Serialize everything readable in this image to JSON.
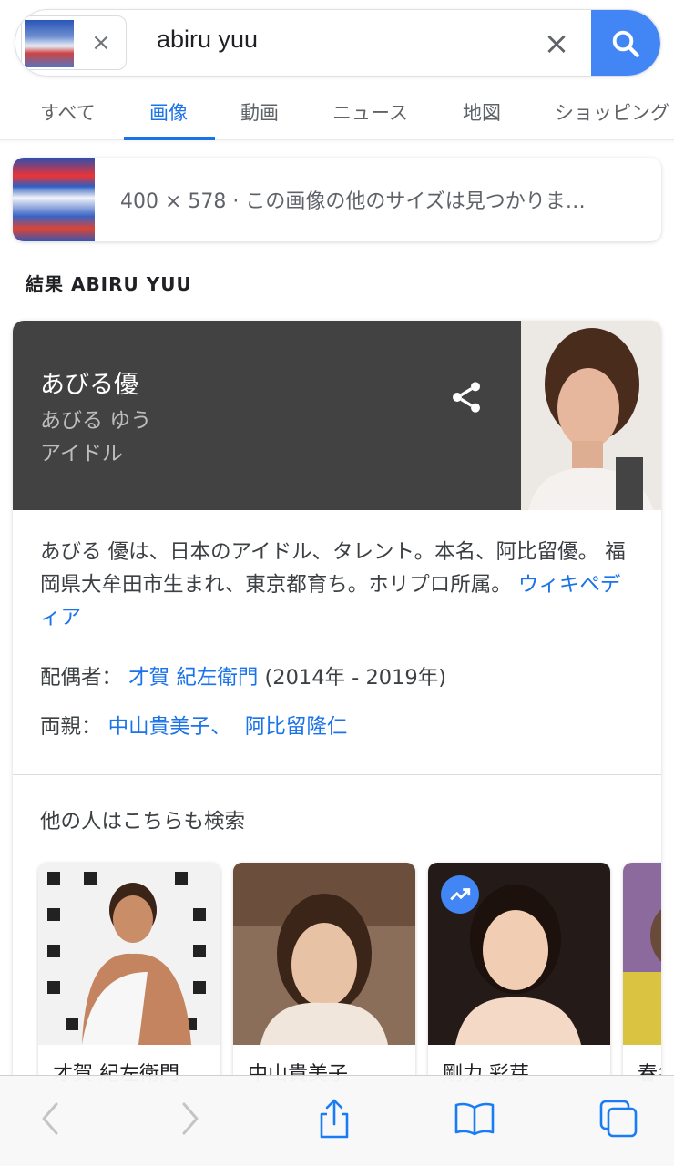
{
  "search": {
    "query": "abiru yuu",
    "chip_remove": "×",
    "clear": "×"
  },
  "tabs": [
    {
      "label": "すべて"
    },
    {
      "label": "画像",
      "active": true
    },
    {
      "label": "動画"
    },
    {
      "label": "ニュース"
    },
    {
      "label": "地図"
    },
    {
      "label": "ショッピング"
    }
  ],
  "image_info": {
    "text": "400 × 578 · この画像の他のサイズは見つかりま…"
  },
  "results_heading": "結果 ABIRU YUU",
  "knowledge_panel": {
    "name": "あびる優",
    "reading": "あびる ゆう",
    "type": "アイドル",
    "description": "あびる 優は、日本のアイドル、タレント。本名、阿比留優。 福岡県大牟田市生まれ、東京都育ち。ホリプロ所属。",
    "source_link": "ウィキペディア",
    "spouse_label": "配偶者：",
    "spouse_link": "才賀 紀左衛門",
    "spouse_years": "(2014年 - 2019年)",
    "parents_label": "両親：",
    "parent1_link": "中山貴美子、",
    "parent2_link": "阿比留隆仁",
    "also_search_title": "他の人はこちらも検索",
    "people": [
      {
        "name": "才賀 紀左衛門",
        "trending": false
      },
      {
        "name": "中山貴美子",
        "trending": false
      },
      {
        "name": "剛力 彩芽",
        "trending": true
      },
      {
        "name": "春名",
        "trending": false
      }
    ]
  },
  "colors": {
    "accent": "#1a73e8",
    "search_button": "#4285f4",
    "panel_header": "#424242"
  },
  "icons": {
    "back": "chevron-left-icon",
    "forward": "chevron-right-icon",
    "share": "share-icon",
    "bookmarks": "book-icon",
    "tabs": "tabs-icon"
  }
}
